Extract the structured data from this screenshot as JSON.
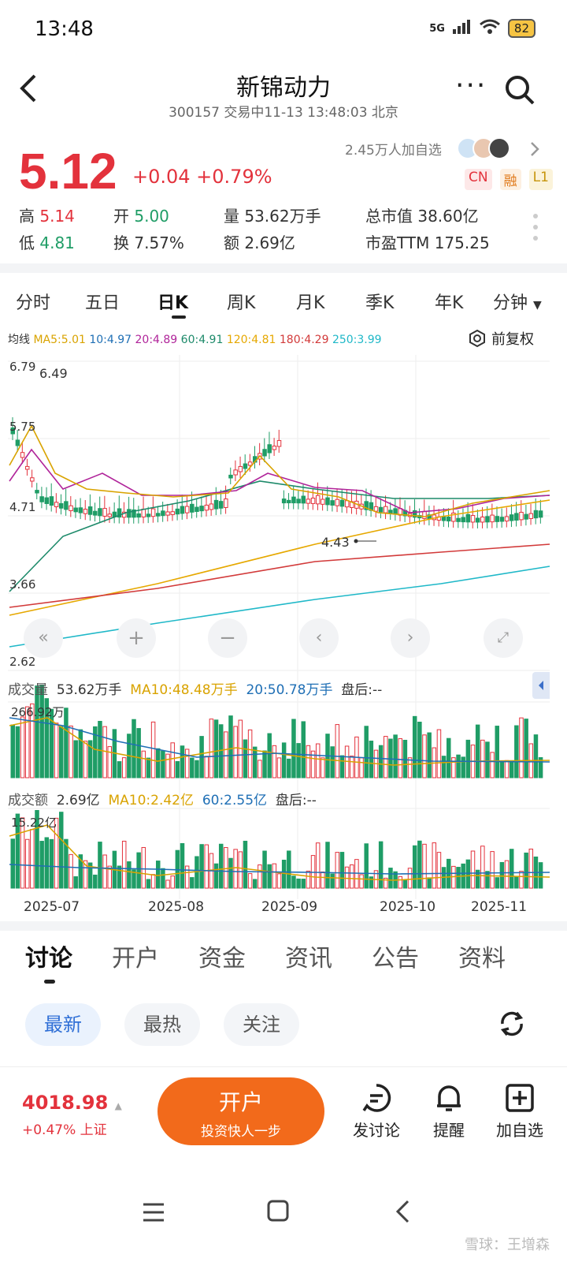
{
  "status": {
    "time": "13:48",
    "network": "5G",
    "battery": "82"
  },
  "header": {
    "title": "新锦动力",
    "subtitle": "300157 交易中11-13 13:48:03 北京"
  },
  "quote": {
    "price": "5.12",
    "change": "+0.04 +0.79%",
    "watchers": "2.45万人加自选",
    "tags": [
      "CN",
      "融",
      "L1"
    ],
    "high_label": "高",
    "high": "5.14",
    "open_label": "开",
    "open": "5.00",
    "volume_label": "量",
    "volume": "53.62万手",
    "mktcap_label": "总市值",
    "mktcap": "38.60亿",
    "low_label": "低",
    "low": "4.81",
    "turnover_label": "换",
    "turnover": "7.57%",
    "amount_label": "额",
    "amount": "2.69亿",
    "pe_label": "市盈TTM",
    "pe": "175.25"
  },
  "period_tabs": [
    "分时",
    "五日",
    "日K",
    "周K",
    "月K",
    "季K",
    "年K",
    "分钟"
  ],
  "ma": {
    "label": "均线",
    "items": [
      {
        "text": "MA5:5.01",
        "color": "#d9a300"
      },
      {
        "text": "10:4.97",
        "color": "#1f6fb5"
      },
      {
        "text": "20:4.89",
        "color": "#b0249a"
      },
      {
        "text": "60:4.91",
        "color": "#1d8a6a"
      },
      {
        "text": "120:4.81",
        "color": "#e6a800"
      },
      {
        "text": "180:4.29",
        "color": "#d23a3a"
      },
      {
        "text": "250:3.99",
        "color": "#1fb8c8"
      }
    ],
    "adjust": "前复权"
  },
  "price_axis": {
    "top_left": "6.79",
    "top_mark": "6.49",
    "l1": "5.75",
    "l2": "4.71",
    "l3": "3.66",
    "l4": "2.62",
    "low_mark": "4.43"
  },
  "volume_row": {
    "label": "成交量",
    "v": "53.62万手",
    "ma10": "MA10:48.48万手",
    "ma20": "20:50.78万手",
    "after": "盘后:--",
    "max": "266.92万"
  },
  "amount_row": {
    "label": "成交额",
    "v": "2.69亿",
    "ma10": "MA10:2.42亿",
    "ma60": "60:2.55亿",
    "after": "盘后:--",
    "max": "15.22亿"
  },
  "x_axis": [
    "2025-07",
    "2025-08",
    "2025-09",
    "2025-10",
    "2025-11"
  ],
  "content_tabs": [
    "讨论",
    "开户",
    "资金",
    "资讯",
    "公告",
    "资料"
  ],
  "filters": [
    "最新",
    "最热",
    "关注"
  ],
  "bottom": {
    "index_value": "4018.98",
    "index_change": "+0.47% 上证",
    "open_title": "开户",
    "open_sub": "投资快人一步",
    "actions": [
      "发讨论",
      "提醒",
      "加自选"
    ]
  },
  "watermark": "雪球：王增森"
}
